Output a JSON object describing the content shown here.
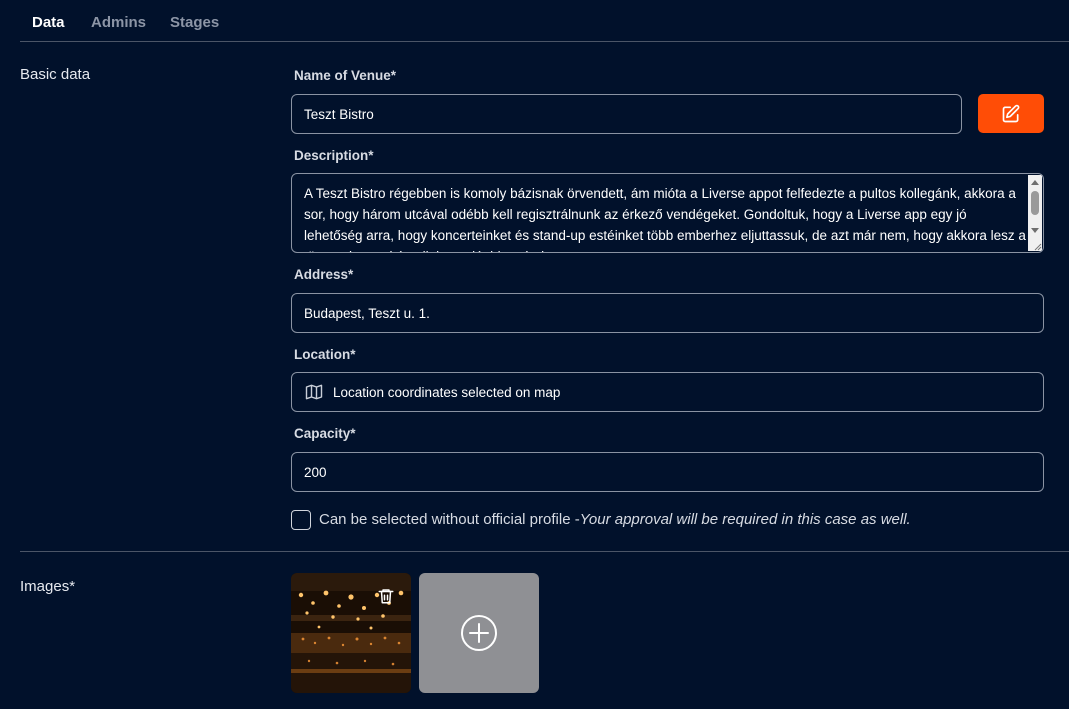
{
  "tabs": [
    {
      "label": "Data",
      "active": true
    },
    {
      "label": "Admins",
      "active": false
    },
    {
      "label": "Stages",
      "active": false
    }
  ],
  "basic_data": {
    "title": "Basic data",
    "name": {
      "label": "Name of Venue*",
      "value": "Teszt Bistro"
    },
    "description": {
      "label": "Description*",
      "value": "A Teszt Bistro régebben is komoly bázisnak örvendett, ám mióta a Liverse appot felfedezte a pultos kollegánk, akkora a sor, hogy három utcával odébb kell regisztrálnunk az érkező vendégeket. Gondoltuk, hogy a Liverse app egy jó lehetőség arra, hogy koncerteinket és stand-up estéinket több emberhez eljuttassuk, de azt már nem, hogy akkora lesz a tömeg, hogy eltévedjek a saját bisztrómban."
    },
    "address": {
      "label": "Address*",
      "value": "Budapest, Teszt u. 1."
    },
    "location": {
      "label": "Location*",
      "value": "Location coordinates selected on map",
      "icon": "map-icon"
    },
    "capacity": {
      "label": "Capacity*",
      "value": "200"
    },
    "official_profile": {
      "checked": false,
      "label": "Can be selected without official profile -",
      "note": "Your approval will be required in this case as well."
    }
  },
  "images": {
    "title": "Images*",
    "icons": {
      "delete": "trash-icon",
      "add": "plus-circle-icon"
    }
  },
  "colors": {
    "background": "#01112b",
    "accent": "#ff4d06",
    "border": "#8a93a3",
    "add_tile": "#8f9094"
  }
}
